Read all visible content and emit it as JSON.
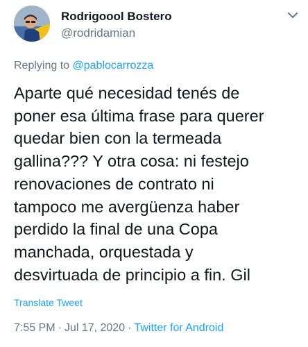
{
  "user": {
    "display_name": "Rodrigoool Bostero",
    "handle": "@rodridamian"
  },
  "reply": {
    "prefix": "Replying to ",
    "mention": "@pablocarrozza"
  },
  "tweet": {
    "lines": [
      "Aparte qué necesidad tenés de",
      "poner esa última frase para querer",
      "quedar bien con la termeada",
      "gallina??? Y otra cosa: ni festejo",
      "renovaciones de contrato ni",
      "tampoco me avergüenza haber",
      "perdido la final de una Copa",
      "manchada, orquestada y",
      "desvirtuada de principio a fin. Gil"
    ]
  },
  "translate_label": "Translate Tweet",
  "meta": {
    "time": "7:55 PM",
    "separator": "·",
    "date": "Jul 17, 2020",
    "source": "Twitter for Android"
  },
  "icons": {
    "avatar": "user-avatar-photo",
    "more": "chevron-down-icon"
  },
  "colors": {
    "text": "#14171a",
    "muted": "#657786",
    "link": "#1da1f2"
  }
}
